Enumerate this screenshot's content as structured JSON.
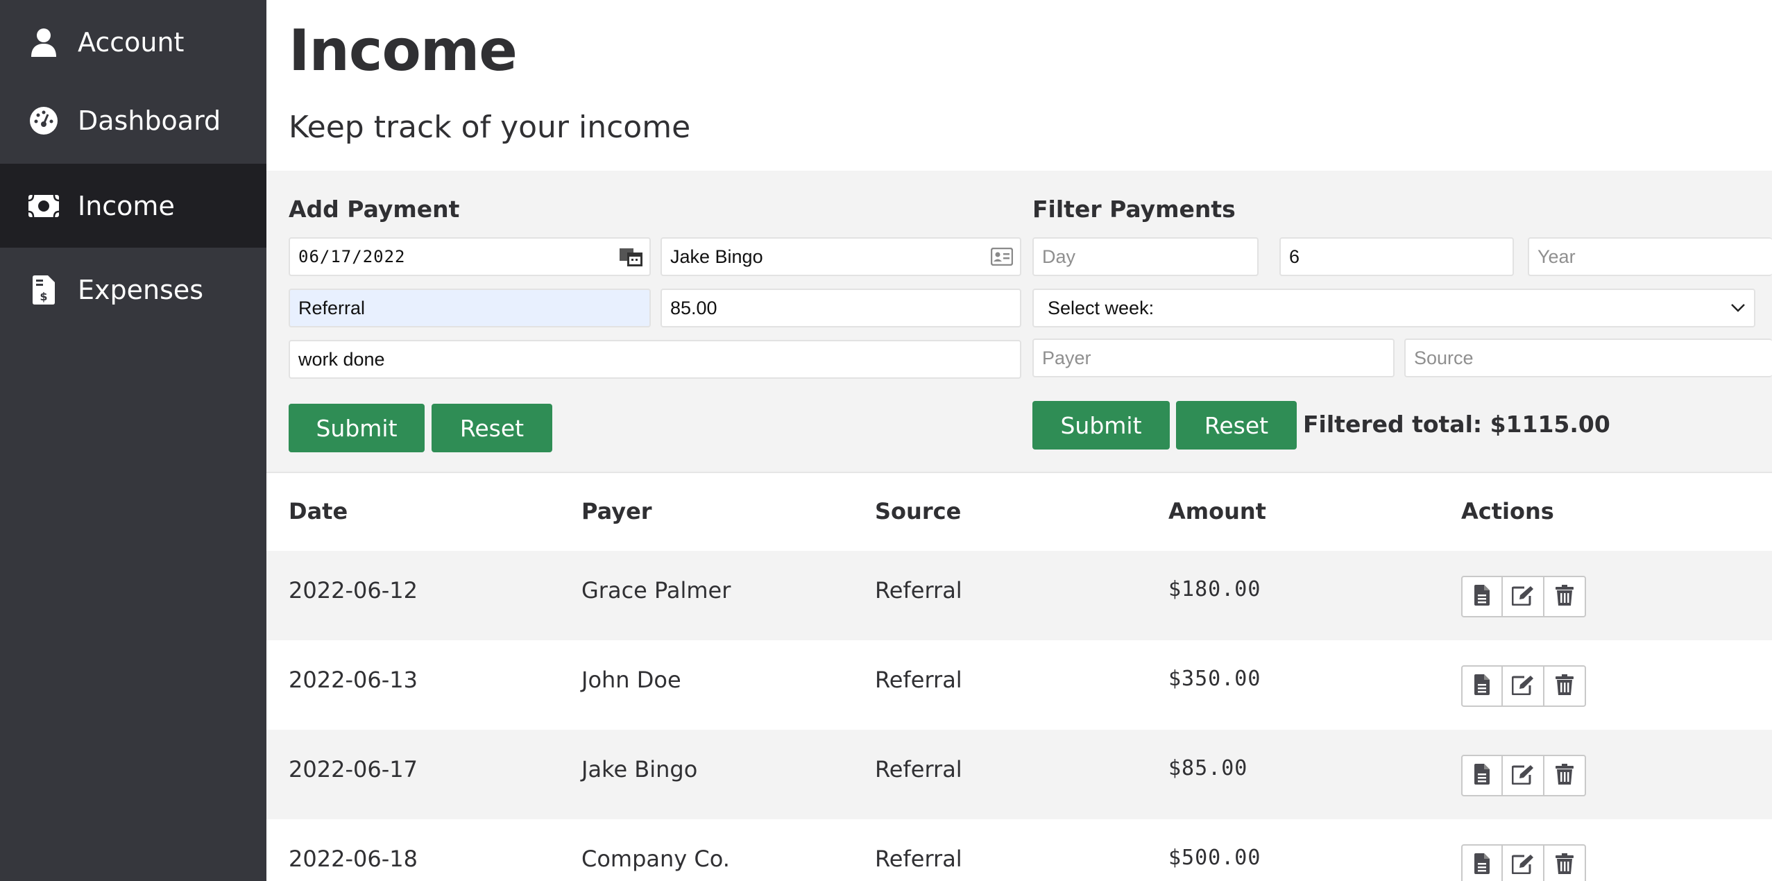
{
  "sidebar": {
    "items": [
      {
        "label": "Account",
        "icon": "user-icon"
      },
      {
        "label": "Dashboard",
        "icon": "gauge-icon"
      },
      {
        "label": "Income",
        "icon": "money-bill-icon",
        "active": true
      },
      {
        "label": "Expenses",
        "icon": "invoice-dollar-icon"
      }
    ]
  },
  "header": {
    "title": "Income",
    "subtitle": "Keep track of your income"
  },
  "add_payment": {
    "title": "Add Payment",
    "date_value": "06/17/2022",
    "payer_value": "Jake Bingo",
    "source_value": "Referral",
    "amount_value": "85.00",
    "notes_value": "work done",
    "submit_label": "Submit",
    "reset_label": "Reset"
  },
  "filter_payments": {
    "title": "Filter Payments",
    "day_placeholder": "Day",
    "month_value": "6",
    "year_placeholder": "Year",
    "week_selected": "Select week:",
    "payer_placeholder": "Payer",
    "source_placeholder": "Source",
    "submit_label": "Submit",
    "reset_label": "Reset",
    "filtered_total": "Filtered total: $1115.00"
  },
  "table": {
    "columns": [
      "Date",
      "Payer",
      "Source",
      "Amount",
      "Actions"
    ],
    "rows": [
      {
        "date": "2022-06-12",
        "payer": "Grace Palmer",
        "source": "Referral",
        "amount": "$180.00"
      },
      {
        "date": "2022-06-13",
        "payer": "John Doe",
        "source": "Referral",
        "amount": "$350.00"
      },
      {
        "date": "2022-06-17",
        "payer": "Jake Bingo",
        "source": "Referral",
        "amount": "$85.00"
      },
      {
        "date": "2022-06-18",
        "payer": "Company Co.",
        "source": "Referral",
        "amount": "$500.00"
      }
    ]
  },
  "colors": {
    "sidebar": "#36373d",
    "sidebar_active": "#1f1f23",
    "button": "#2f8d55",
    "panel": "#f3f3f3"
  }
}
